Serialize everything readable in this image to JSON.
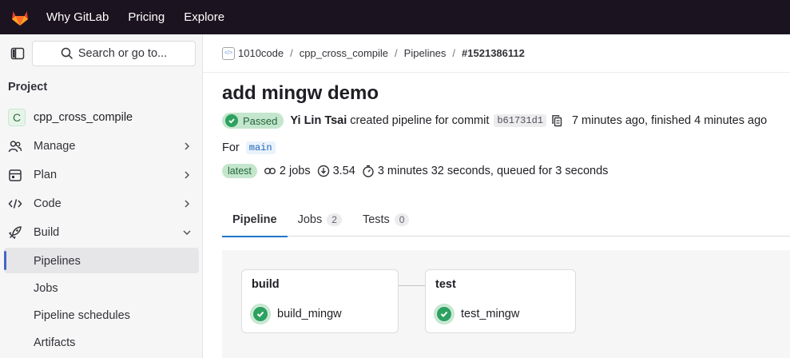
{
  "topbar": {
    "links": [
      "Why GitLab",
      "Pricing",
      "Explore"
    ]
  },
  "sidebar": {
    "search_label": "Search or go to...",
    "section_heading": "Project",
    "project": {
      "avatar_letter": "C",
      "name": "cpp_cross_compile"
    },
    "items": [
      {
        "label": "Manage",
        "icon": "users-icon",
        "chevron": "right"
      },
      {
        "label": "Plan",
        "icon": "calendar-icon",
        "chevron": "right"
      },
      {
        "label": "Code",
        "icon": "code-icon",
        "chevron": "right"
      },
      {
        "label": "Build",
        "icon": "rocket-icon",
        "chevron": "down"
      }
    ],
    "sub_items": [
      "Pipelines",
      "Jobs",
      "Pipeline schedules",
      "Artifacts"
    ],
    "active_sub_item": "Pipelines"
  },
  "breadcrumb": [
    "1010code",
    "cpp_cross_compile",
    "Pipelines",
    "#1521386112"
  ],
  "pipeline": {
    "title": "add mingw demo",
    "status": "Passed",
    "author": "Yi Lin Tsai",
    "created_text": "created pipeline for commit",
    "commit_sha": "b61731d1",
    "time_text": "7 minutes ago, finished 4 minutes ago",
    "for_label": "For",
    "branch": "main",
    "latest_badge": "latest",
    "jobs_count": "2 jobs",
    "coverage": "3.54",
    "duration": "3 minutes 32 seconds, queued for 3 seconds"
  },
  "tabs": [
    {
      "label": "Pipeline",
      "count": null,
      "active": true
    },
    {
      "label": "Jobs",
      "count": "2",
      "active": false
    },
    {
      "label": "Tests",
      "count": "0",
      "active": false
    }
  ],
  "stages": [
    {
      "name": "build",
      "jobs": [
        "build_mingw"
      ]
    },
    {
      "name": "test",
      "jobs": [
        "test_mingw"
      ]
    }
  ],
  "colors": {
    "topbar_bg": "#1c1320",
    "success": "#2da160",
    "active_tab_underline": "#1f75cb",
    "sidebar_active_marker": "#4367c8"
  }
}
